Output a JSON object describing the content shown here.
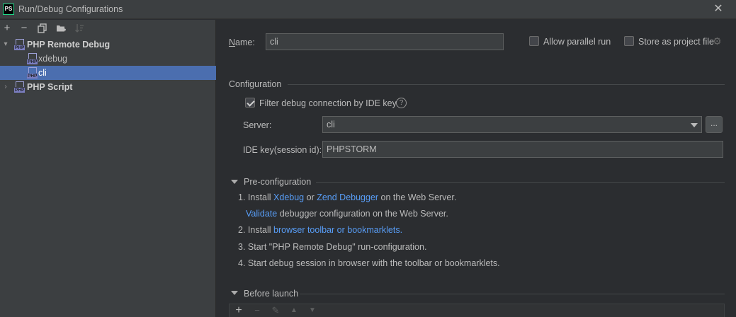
{
  "window": {
    "title": "Run/Debug Configurations",
    "logo_text": "PS",
    "close_glyph": "✕"
  },
  "toolbar": {
    "add_glyph": "+",
    "remove_glyph": "−",
    "copy_icon": "copy-icon",
    "folder_icon": "folder-add-icon",
    "sort_icon": "sort-icon"
  },
  "tree": {
    "groups": [
      {
        "label": "PHP Remote Debug",
        "expanded": true,
        "icon_text": "PHP"
      },
      {
        "label": "PHP Script",
        "expanded": false,
        "icon_text": "PHP"
      }
    ],
    "children": [
      {
        "label": "xdebug",
        "icon_text": "PHP",
        "selected": false
      },
      {
        "label": "cli",
        "icon_text": "PHP",
        "selected": true
      }
    ]
  },
  "form": {
    "name_label": "Name:",
    "name_value": "cli",
    "allow_parallel_label": "Allow parallel run",
    "allow_parallel_checked": false,
    "store_project_label": "Store as project file",
    "store_project_checked": false
  },
  "configuration": {
    "section_title": "Configuration",
    "filter_label": "Filter debug connection by IDE key",
    "filter_checked": true,
    "server_label": "Server:",
    "server_value": "cli",
    "browse_label": "...",
    "ide_key_label": "IDE key(session id):",
    "ide_key_value": "PHPSTORM"
  },
  "preconfig": {
    "section_title": "Pre-configuration",
    "step1_prefix": "1. Install ",
    "step1_link1": "Xdebug",
    "step1_mid": " or ",
    "step1_link2": "Zend Debugger",
    "step1_suffix": " on the Web Server.",
    "step1b_link": "Validate",
    "step1b_suffix": " debugger configuration on the Web Server.",
    "step2_prefix": "2. Install ",
    "step2_link": "browser toolbar or bookmarklets.",
    "step3": "3. Start \"PHP Remote Debug\" run-configuration.",
    "step4": "4. Start debug session in browser with the toolbar or bookmarklets."
  },
  "before_launch": {
    "section_title": "Before launch",
    "add_glyph": "+",
    "remove_glyph": "−",
    "edit_glyph": "✎",
    "up_glyph": "▲",
    "down_glyph": "▼"
  },
  "colors": {
    "accent_selection": "#4b6eaf",
    "link": "#589df6",
    "background": "#2b2d30"
  }
}
